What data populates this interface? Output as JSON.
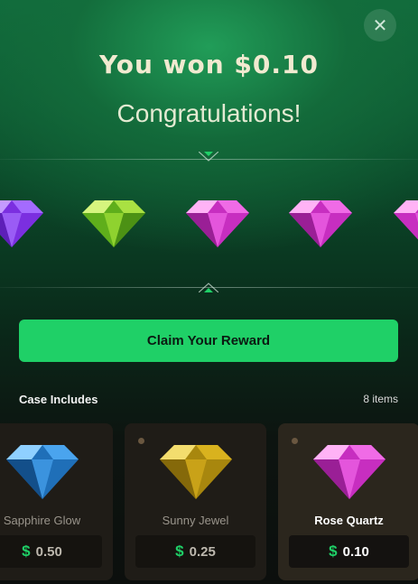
{
  "modal": {
    "title": "You won $0.10",
    "subtitle": "Congratulations!",
    "close_symbol": "✕"
  },
  "reel": {
    "gems": [
      {
        "icon": "purple-gem-icon",
        "color": "#8a3cf0"
      },
      {
        "icon": "green-gem-icon",
        "color": "#7fd12c"
      },
      {
        "icon": "pink-gem-icon",
        "color": "#e04ad8"
      },
      {
        "icon": "pink-gem-icon",
        "color": "#e04ad8"
      },
      {
        "icon": "pink-gem-icon",
        "color": "#e04ad8"
      }
    ]
  },
  "claim": {
    "label": "Claim Your Reward"
  },
  "case": {
    "title": "Case Includes",
    "count": "8 items",
    "items": [
      {
        "name": "Sapphire Glow",
        "currency": "$",
        "price": "0.50",
        "icon": "blue-gem-icon",
        "color": "#2f8fe0"
      },
      {
        "name": "Sunny Jewel",
        "currency": "$",
        "price": "0.25",
        "icon": "yellow-gem-icon",
        "color": "#d9b21e"
      },
      {
        "name": "Rose Quartz",
        "currency": "$",
        "price": "0.10",
        "icon": "pink-gem-icon",
        "color": "#e04ad8"
      }
    ]
  },
  "colors": {
    "accent": "#1fd067",
    "background": "#0c0f0d"
  }
}
